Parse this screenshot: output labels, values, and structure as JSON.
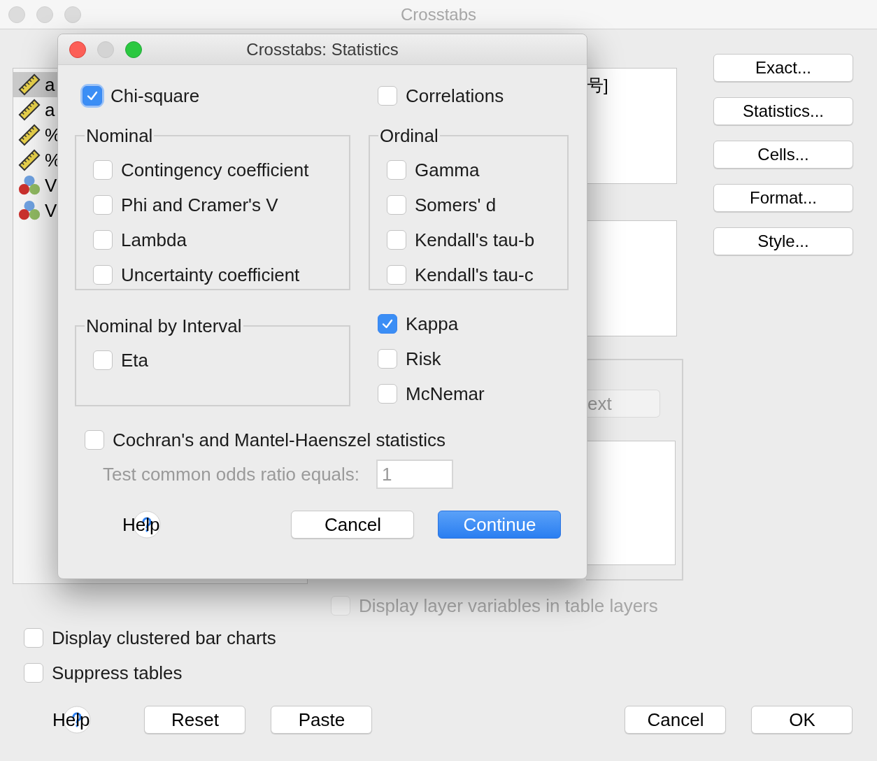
{
  "window": {
    "title": "Crosstabs"
  },
  "variables": [
    {
      "label": "a",
      "kind": "scale",
      "selected": true
    },
    {
      "label": "a",
      "kind": "scale",
      "selected": false
    },
    {
      "label": "%",
      "kind": "scale",
      "selected": false
    },
    {
      "label": "%",
      "kind": "scale",
      "selected": false
    },
    {
      "label": "V",
      "kind": "nominal",
      "selected": false
    },
    {
      "label": "V",
      "kind": "nominal",
      "selected": false
    }
  ],
  "target_box_text": "号]",
  "side_buttons": [
    "Exact...",
    "Statistics...",
    "Cells...",
    "Format...",
    "Style..."
  ],
  "layer_next_button": {
    "label": "ext",
    "disabled": true
  },
  "layer_option": {
    "label": "Display layer variables in table layers",
    "checked": false,
    "disabled": true
  },
  "options": [
    {
      "label": "Display clustered bar charts",
      "checked": false
    },
    {
      "label": "Suppress tables",
      "checked": false
    }
  ],
  "buttons": [
    {
      "label": "Help",
      "kind": "help"
    },
    {
      "label": "Reset",
      "kind": "push"
    },
    {
      "label": "Paste",
      "kind": "push"
    },
    {
      "label": "Cancel",
      "kind": "push"
    },
    {
      "label": "OK",
      "kind": "push"
    }
  ],
  "dialog": {
    "title": "Crosstabs: Statistics",
    "chi_square": {
      "label": "Chi-square",
      "checked": true
    },
    "correlations": {
      "label": "Correlations",
      "checked": false
    },
    "nominal": {
      "title": "Nominal",
      "items": [
        {
          "label": "Contingency coefficient",
          "checked": false
        },
        {
          "label": "Phi and Cramer's V",
          "checked": false
        },
        {
          "label": "Lambda",
          "checked": false
        },
        {
          "label": "Uncertainty coefficient",
          "checked": false
        }
      ]
    },
    "ordinal": {
      "title": "Ordinal",
      "items": [
        {
          "label": "Gamma",
          "checked": false
        },
        {
          "label": "Somers' d",
          "checked": false
        },
        {
          "label": "Kendall's tau-b",
          "checked": false
        },
        {
          "label": "Kendall's tau-c",
          "checked": false
        }
      ]
    },
    "nominal_by_interval": {
      "title": "Nominal by Interval",
      "items": [
        {
          "label": "Eta",
          "checked": false
        }
      ]
    },
    "other": [
      {
        "label": "Kappa",
        "checked": true
      },
      {
        "label": "Risk",
        "checked": false
      },
      {
        "label": "McNemar",
        "checked": false
      }
    ],
    "cochran": {
      "label": "Cochran's and Mantel-Haenszel statistics",
      "checked": false
    },
    "odds_ratio": {
      "label": "Test common odds ratio equals:",
      "value": "1",
      "disabled": true
    },
    "buttons": [
      {
        "label": "Help",
        "kind": "help"
      },
      {
        "label": "Cancel",
        "kind": "push"
      },
      {
        "label": "Continue",
        "kind": "default"
      }
    ]
  }
}
